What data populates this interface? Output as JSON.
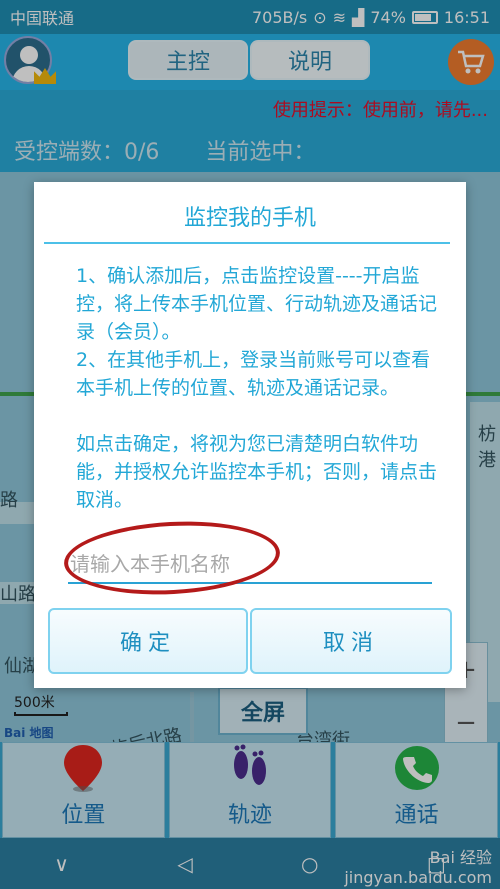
{
  "status_bar": {
    "carrier": "中国联通",
    "speed": "705B/s",
    "battery": "74%",
    "time": "16:51"
  },
  "header": {
    "tab_main": "主控",
    "tab_help": "说明"
  },
  "tip": "使用提示：使用前，请先...",
  "count_row": {
    "controlled": "受控端数：0/6",
    "selected": "当前选中："
  },
  "map": {
    "labels": [
      "枋港",
      "路",
      "山路",
      "仙湖",
      "屿后北路",
      "台湾街"
    ],
    "scale": "500米",
    "baidu_logo": "Bai 地图",
    "fullscreen": "全屏",
    "zoom_in": "+",
    "zoom_out": "−"
  },
  "bottom_nav": {
    "location": "位置",
    "track": "轨迹",
    "call": "通话"
  },
  "watermark": "Bai 经验\njingyan.baidu.com",
  "dialog": {
    "title": "监控我的手机",
    "para1": "1、确认添加后，点击监控设置----开启监控，将上传本手机位置、行动轨迹及通话记录（会员）。",
    "para2": "2、在其他手机上，登录当前账号可以查看本手机上传的位置、轨迹及通话记录。",
    "para3": "如点击确定，将视为您已清楚明白软件功能，并授权允许监控本手机；否则，请点击取消。",
    "input_placeholder": "请输入本手机名称",
    "ok": "确定",
    "cancel": "取消"
  },
  "colors": {
    "accent": "#27b6ea",
    "dialog_text": "#22a7d6",
    "warning": "#e5112b",
    "annotation": "#b41a1a"
  }
}
